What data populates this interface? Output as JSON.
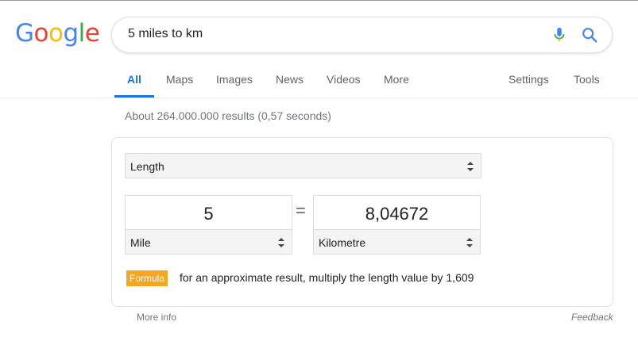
{
  "logo": {
    "letters": [
      {
        "char": "G",
        "color": "#4285F4"
      },
      {
        "char": "o",
        "color": "#EA4335"
      },
      {
        "char": "o",
        "color": "#FBBC05"
      },
      {
        "char": "g",
        "color": "#4285F4"
      },
      {
        "char": "l",
        "color": "#34A853"
      },
      {
        "char": "e",
        "color": "#EA4335"
      }
    ]
  },
  "search": {
    "query": "5 miles to km",
    "mic_icon": "microphone-icon",
    "search_icon": "search-icon"
  },
  "tabs": {
    "all": "All",
    "maps": "Maps",
    "images": "Images",
    "news": "News",
    "videos": "Videos",
    "more": "More",
    "settings": "Settings",
    "tools": "Tools",
    "active_color": "#1a73e8"
  },
  "results": {
    "stats": "About 264.000.000 results (0,57 seconds)"
  },
  "converter": {
    "unit_type": "Length",
    "from": {
      "value": "5",
      "unit": "Mile"
    },
    "equals": "=",
    "to": {
      "value": "8,04672",
      "unit": "Kilometre"
    },
    "formula_label": "Formula",
    "formula_text": "for an approximate result, multiply the length value by 1,609",
    "formula_color": "#f5a623"
  },
  "footer": {
    "more_info": "More info",
    "feedback": "Feedback"
  }
}
